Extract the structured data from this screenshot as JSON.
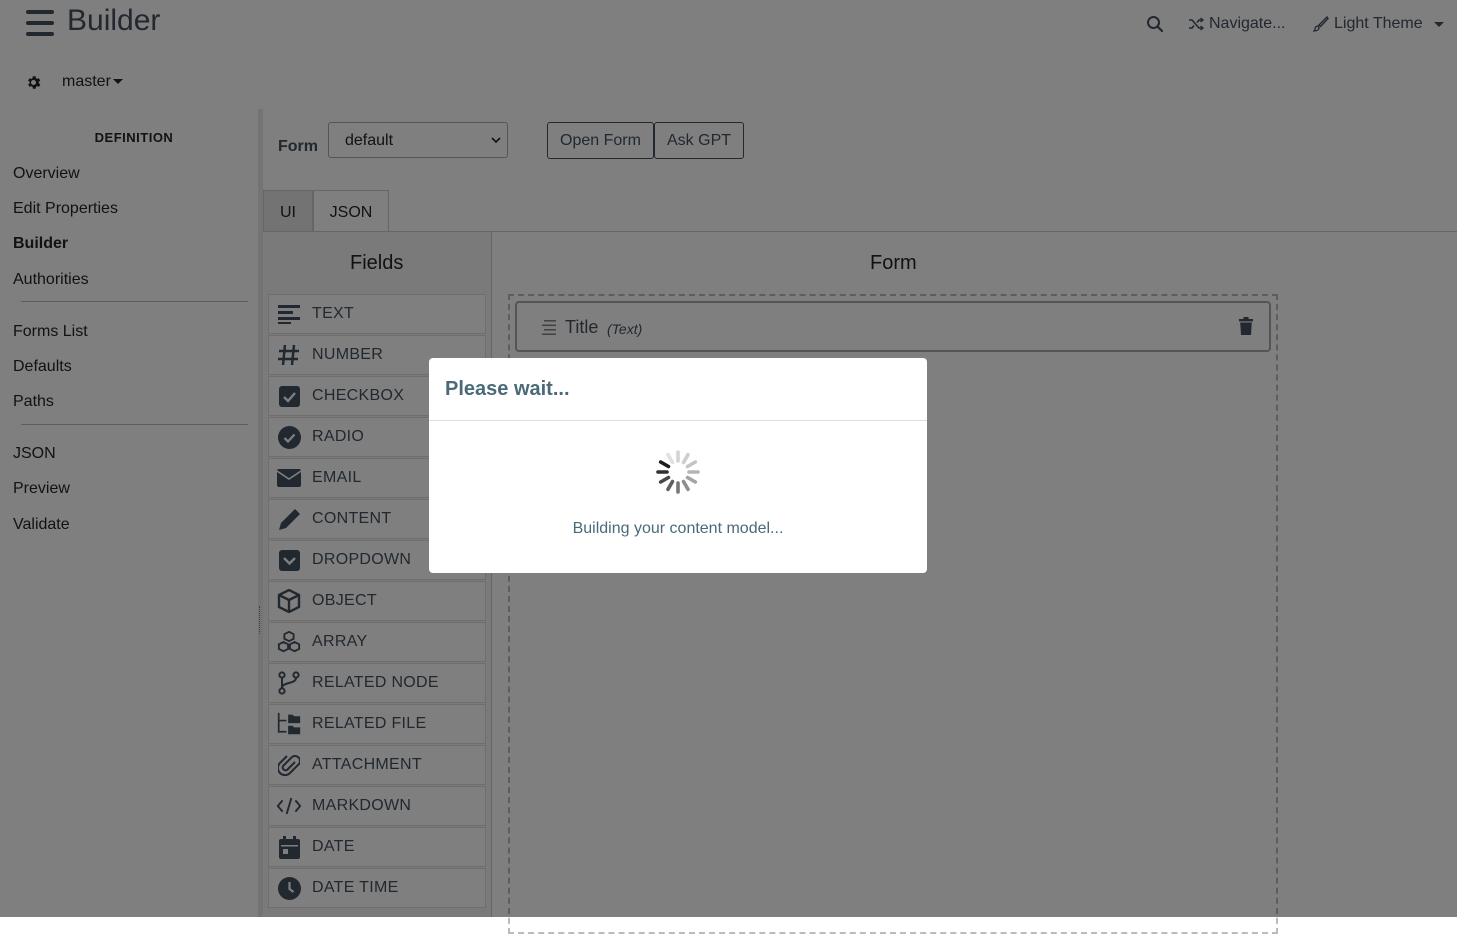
{
  "header": {
    "brand": "Builder",
    "search_icon": "search-icon",
    "navigate_label": "Navigate...",
    "theme_label": "Light Theme",
    "branch_label": "master"
  },
  "sidebar": {
    "section_title": "DEFINITION",
    "group1": [
      {
        "label": "Overview",
        "active": false
      },
      {
        "label": "Edit Properties",
        "active": false
      },
      {
        "label": "Builder",
        "active": true
      },
      {
        "label": "Authorities",
        "active": false
      }
    ],
    "group2": [
      {
        "label": "Forms List"
      },
      {
        "label": "Defaults"
      },
      {
        "label": "Paths"
      }
    ],
    "group3": [
      {
        "label": "JSON"
      },
      {
        "label": "Preview"
      },
      {
        "label": "Validate"
      }
    ]
  },
  "toolbar": {
    "form_label": "Form",
    "form_select_value": "default",
    "open_form_label": "Open Form",
    "ask_gpt_label": "Ask GPT"
  },
  "tabs": [
    {
      "label": "UI",
      "active": true
    },
    {
      "label": "JSON",
      "active": false
    }
  ],
  "fields_panel": {
    "title": "Fields",
    "items": [
      {
        "label": "TEXT",
        "icon": "text-lines-icon"
      },
      {
        "label": "NUMBER",
        "icon": "hash-icon"
      },
      {
        "label": "CHECKBOX",
        "icon": "checkbox-icon"
      },
      {
        "label": "RADIO",
        "icon": "radio-check-icon"
      },
      {
        "label": "EMAIL",
        "icon": "envelope-icon"
      },
      {
        "label": "CONTENT",
        "icon": "pencil-icon"
      },
      {
        "label": "DROPDOWN",
        "icon": "dropdown-icon"
      },
      {
        "label": "OBJECT",
        "icon": "cube-icon"
      },
      {
        "label": "ARRAY",
        "icon": "cubes-icon"
      },
      {
        "label": "RELATED NODE",
        "icon": "code-branch-icon"
      },
      {
        "label": "RELATED FILE",
        "icon": "folder-tree-icon"
      },
      {
        "label": "ATTACHMENT",
        "icon": "paperclip-icon"
      },
      {
        "label": "MARKDOWN",
        "icon": "code-icon"
      },
      {
        "label": "DATE",
        "icon": "calendar-icon"
      },
      {
        "label": "DATE TIME",
        "icon": "clock-icon"
      }
    ]
  },
  "form_panel": {
    "title": "Form",
    "fields": [
      {
        "name": "Title",
        "type": "(Text)"
      }
    ]
  },
  "modal": {
    "title": "Please wait...",
    "message": "Building your content model..."
  },
  "colors": {
    "accent": "#44505f",
    "modal_text": "#4a6a7a",
    "overlay": "rgba(0,0,0,0.5)"
  }
}
